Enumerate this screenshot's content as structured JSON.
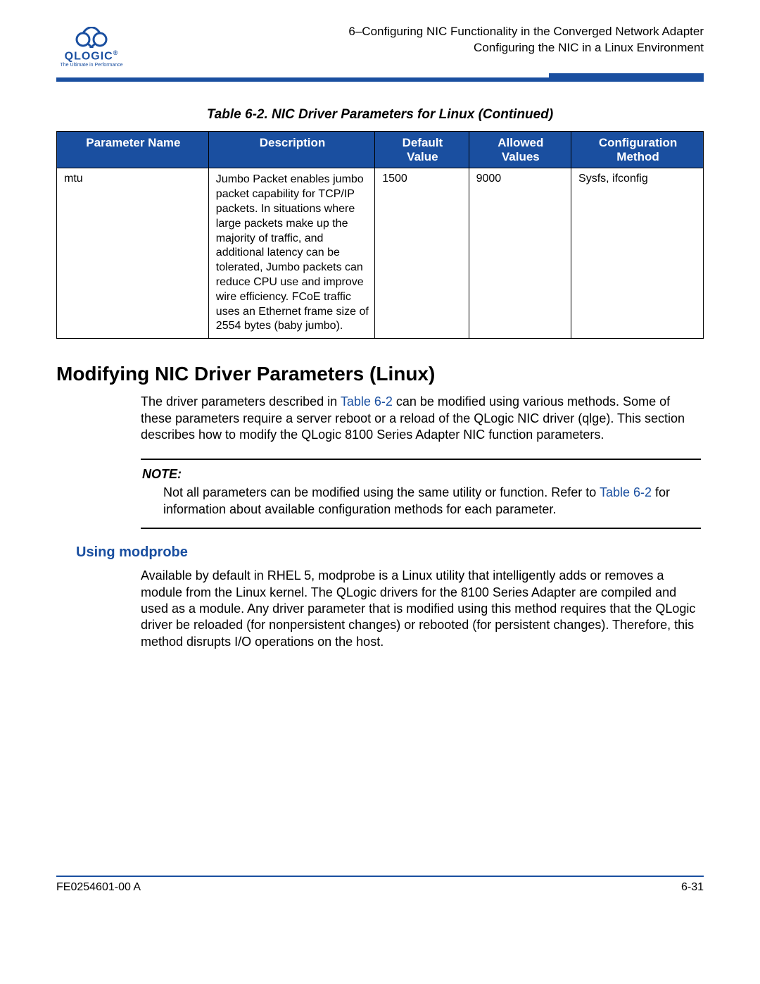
{
  "header": {
    "logo_text": "QLOGIC",
    "logo_tag": "The Ultimate in Performance",
    "line1": "6–Configuring NIC Functionality in the Converged Network Adapter",
    "line2": "Configuring the NIC in a Linux Environment"
  },
  "table": {
    "caption": "Table 6-2. NIC Driver Parameters for Linux (Continued)",
    "headers": {
      "param": "Parameter Name",
      "desc": "Description",
      "def": "Default Value",
      "allow": "Allowed Values",
      "conf": "Configuration Method"
    },
    "rows": [
      {
        "param": "mtu",
        "desc": "Jumbo Packet enables jumbo packet capability for TCP/IP packets. In situations where large packets make up the majority of traffic, and additional latency can be tolerated, Jumbo packets can reduce CPU use and improve wire efficiency. FCoE traffic uses an Ethernet frame size of 2554 bytes (baby jumbo).",
        "def": "1500",
        "allow": "9000",
        "conf": "Sysfs, ifconfig"
      }
    ]
  },
  "section": {
    "title": "Modifying NIC Driver Parameters (Linux)",
    "para_pre": "The driver parameters described in ",
    "para_link": "Table 6-2",
    "para_post": " can be modified using various methods. Some of these parameters require a server reboot or a reload of the QLogic NIC driver (qlge). This section describes how to modify the QLogic 8100 Series Adapter NIC function parameters."
  },
  "note": {
    "label": "NOTE:",
    "pre": "Not all parameters can be modified using the same utility or function. Refer to ",
    "link": "Table 6-2",
    "post": " for information about available configuration methods for each parameter."
  },
  "sub": {
    "title": "Using modprobe",
    "para": "Available by default in RHEL 5, modprobe is a Linux utility that intelligently adds or removes a module from the Linux kernel. The QLogic drivers for the 8100 Series Adapter are compiled and used as a module. Any driver parameter that is modified using this method requires that the QLogic driver be reloaded (for nonpersistent changes) or rebooted (for persistent changes). Therefore, this method disrupts I/O operations on the host."
  },
  "footer": {
    "left": "FE0254601-00 A",
    "right": "6-31"
  }
}
